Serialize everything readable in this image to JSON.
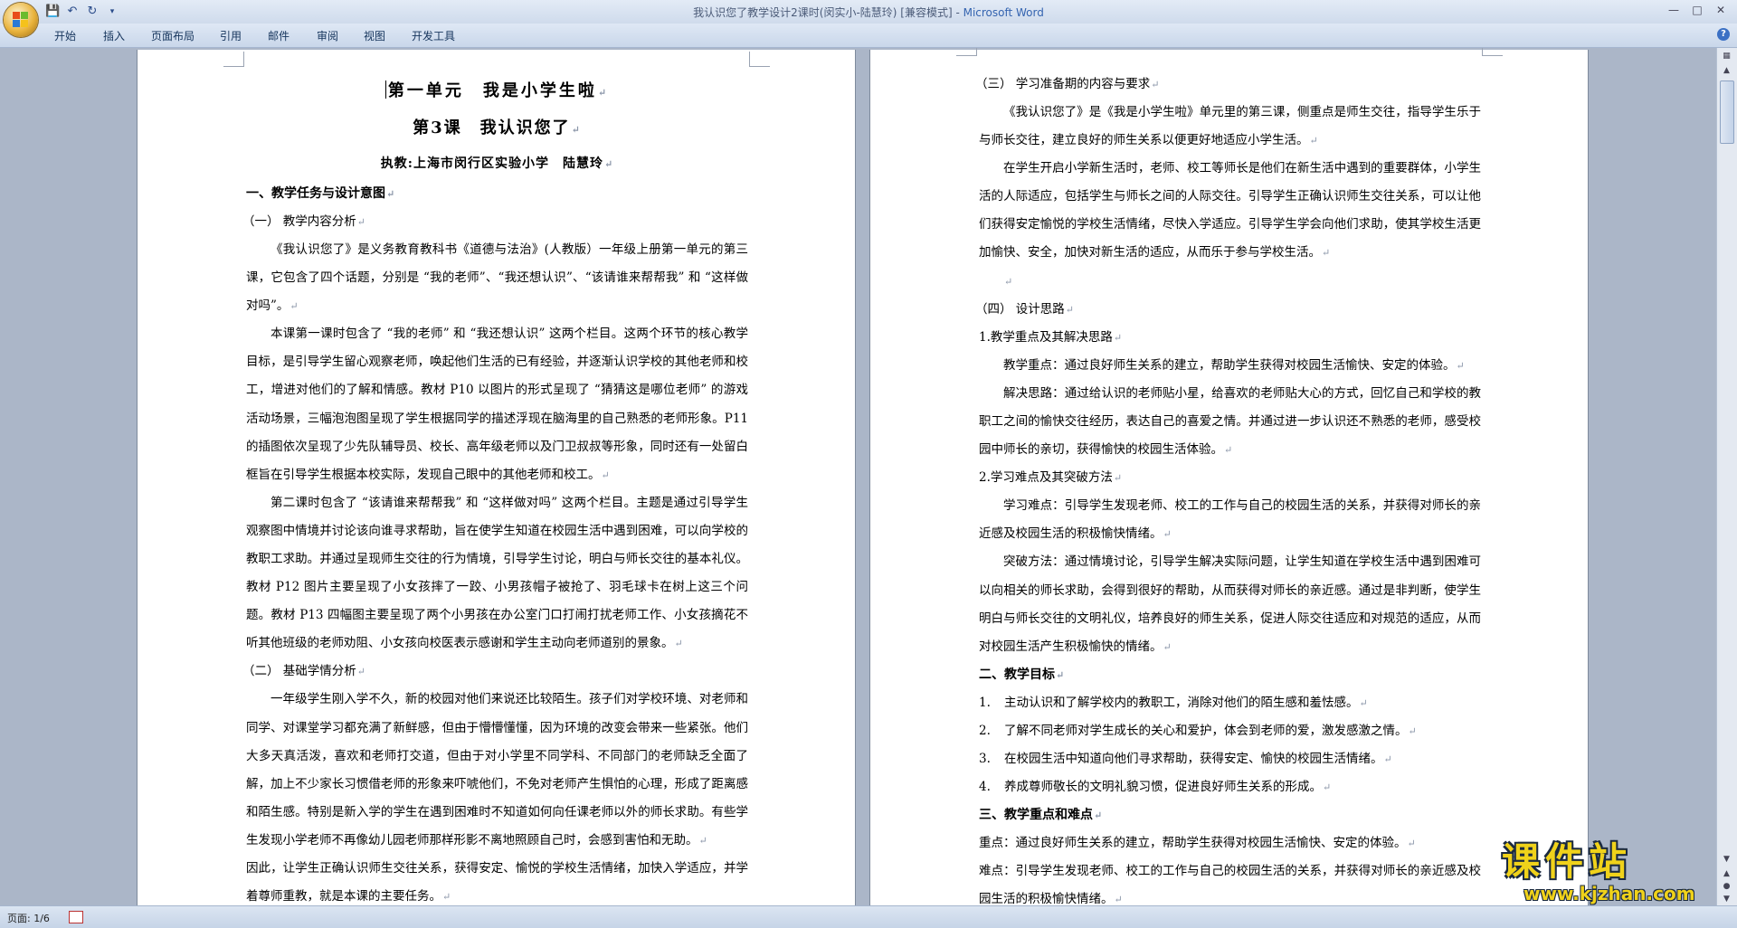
{
  "window": {
    "title": "我认识您了教学设计2课时(闵实小-陆慧玲) [兼容模式] - ",
    "app_name": "Microsoft Word"
  },
  "ribbon": {
    "tabs": [
      "开始",
      "插入",
      "页面布局",
      "引用",
      "邮件",
      "审阅",
      "视图",
      "开发工具"
    ]
  },
  "status_bar": {
    "page": "页面: 1/6"
  },
  "watermark": {
    "text": "课件站",
    "url": "www.kjzhan.com"
  },
  "page_left": {
    "title1": "第一单元　我是小学生啦",
    "title2": "第3课　我认识您了",
    "author": "执教:上海市闵行区实验小学　陆慧玲",
    "sec1": "一、教学任务与设计意图",
    "sub1": "（一）  教学内容分析",
    "p1": "《我认识您了》是义务教育教科书《道德与法治》(人教版）一年级上册第一单元的第三课，它包含了四个话题，分别是 “我的老师”、“我还想认识”、“该请谁来帮帮我” 和 “这样做对吗”。",
    "p2": "本课第一课时包含了 “我的老师” 和 “我还想认识” 这两个栏目。这两个环节的核心教学目标，是引导学生留心观察老师，唤起他们生活的已有经验，并逐渐认识学校的其他老师和校工，增进对他们的了解和情感。教材 P10 以图片的形式呈现了 “猜猜这是哪位老师” 的游戏活动场景，三幅泡泡图呈现了学生根据同学的描述浮现在脑海里的自己熟悉的老师形象。P11 的插图依次呈现了少先队辅导员、校长、高年级老师以及门卫叔叔等形象，同时还有一处留白框旨在引导学生根据本校实际，发现自己眼中的其他老师和校工。",
    "p3": "第二课时包含了 “该请谁来帮帮我” 和 “这样做对吗” 这两个栏目。主题是通过引导学生观察图中情境并讨论该向谁寻求帮助，旨在使学生知道在校园生活中遇到困难，可以向学校的教职工求助。并通过呈现师生交往的行为情境，引导学生讨论，明白与师长交往的基本礼仪。教材 P12 图片主要呈现了小女孩摔了一跤、小男孩帽子被抢了、羽毛球卡在树上这三个问题。教材 P13 四幅图主要呈现了两个小男孩在办公室门口打闹打扰老师工作、小女孩摘花不听其他班级的老师劝阻、小女孩向校医表示感谢和学生主动向老师道别的景象。",
    "sub2": "（二）  基础学情分析",
    "p4": "一年级学生刚入学不久，新的校园对他们来说还比较陌生。孩子们对学校环境、对老师和同学、对课堂学习都充满了新鲜感，但由于懵懵懂懂，因为环境的改变会带来一些紧张。他们大多天真活泼，喜欢和老师打交道，但由于对小学里不同学科、不同部门的老师缺乏全面了解，加上不少家长习惯借老师的形象来吓唬他们，不免对老师产生惧怕的心理，形成了距离感和陌生感。特别是新入学的学生在遇到困难时不知道如何向任课老师以外的师长求助。有些学生发现小学老师不再像幼儿园老师那样形影不离地照顾自己时，会感到害怕和无助。",
    "p5": "因此，让学生正确认识师生交往关系，获得安定、愉悦的学校生活情绪，加快入学适应，并学着尊师重教，就是本课的主要任务。"
  },
  "page_right": {
    "sub3": "（三）  学习准备期的内容与要求",
    "p1": "《我认识您了》是《我是小学生啦》单元里的第三课，侧重点是师生交往，指导学生乐于与师长交往，建立良好的师生关系以便更好地适应小学生活。",
    "p2": "在学生开启小学新生活时，老师、校工等师长是他们在新生活中遇到的重要群体，小学生活的人际适应，包括学生与师长之间的人际交往。引导学生正确认识师生交往关系，可以让他们获得安定愉悦的学校生活情绪，尽快入学适应。引导学生学会向他们求助，使其学校生活更加愉快、安全，加快对新生活的适应，从而乐于参与学校生活。",
    "sub4": "（四）  设计思路",
    "n1": "1.教学重点及其解决思路",
    "p3": "教学重点：通过良好师生关系的建立，帮助学生获得对校园生活愉快、安定的体验。",
    "p4": "解决思路：通过给认识的老师贴小星，给喜欢的老师贴大心的方式，回忆自己和学校的教职工之间的愉快交往经历，表达自己的喜爱之情。并通过进一步认识还不熟悉的老师，感受校园中师长的亲切，获得愉快的校园生活体验。",
    "n2": "2.学习难点及其突破方法",
    "p5": "学习难点：引导学生发现老师、校工的工作与自己的校园生活的关系，并获得对师长的亲近感及校园生活的积极愉快情绪。",
    "p6": "突破方法：通过情境讨论，引导学生解决实际问题，让学生知道在学校生活中遇到困难可以向相关的师长求助，会得到很好的帮助，从而获得对师长的亲近感。通过是非判断，使学生明白与师长交往的文明礼仪，培养良好的师生关系，促进人际交往适应和对规范的适应，从而对校园生活产生积极愉快的情绪。",
    "sec2": "二、教学目标",
    "goals": [
      {
        "n": "1.",
        "t": "主动认识和了解学校内的教职工，消除对他们的陌生感和羞怯感。"
      },
      {
        "n": "2.",
        "t": "了解不同老师对学生成长的关心和爱护，体会到老师的爱，激发感激之情。"
      },
      {
        "n": "3.",
        "t": "在校园生活中知道向他们寻求帮助，获得安定、愉快的校园生活情绪。"
      },
      {
        "n": "4.",
        "t": "养成尊师敬长的文明礼貌习惯，促进良好师生关系的形成。"
      }
    ],
    "sec3": "三、教学重点和难点",
    "key": "重点：通过良好师生关系的建立，帮助学生获得对校园生活愉快、安定的体验。",
    "diff": "难点：引导学生发现老师、校工的工作与自己的校园生活的关系，并获得对师长的亲近感及校园生活的积极愉快情绪。"
  }
}
